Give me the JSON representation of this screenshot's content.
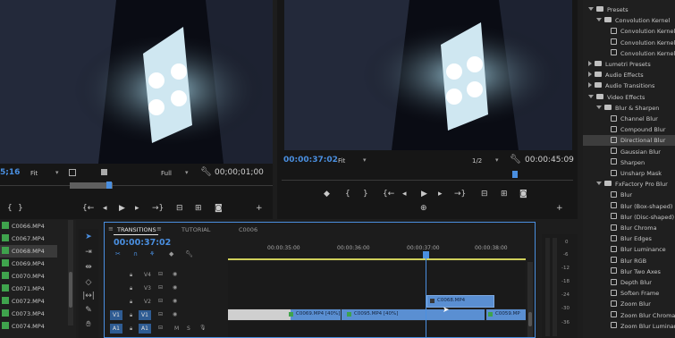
{
  "source_monitor": {
    "timecode_left": "5;16",
    "fit_label": "Fit",
    "zoom_label": "Full",
    "timecode_right": "00;00;01;00"
  },
  "program_monitor": {
    "timecode_left": "00:00:37:02",
    "fit_label": "Fit",
    "quality": "1/2",
    "timecode_right": "00:00:45:09"
  },
  "project": {
    "items": [
      "C0066.MP4",
      "C0067.MP4",
      "C0068.MP4",
      "C0069.MP4",
      "C0070.MP4",
      "C0071.MP4",
      "C0072.MP4",
      "C0073.MP4",
      "C0074.MP4"
    ],
    "selected_index": 2
  },
  "timeline": {
    "tabs": [
      "TRANSITIONS",
      "TUTORIAL",
      "C0006"
    ],
    "timecode": "00:00:37:02",
    "ruler": [
      "00:00:35:00",
      "00:00:36:00",
      "00:00:37:00",
      "00:00:38:00"
    ],
    "tracks": {
      "v4": "V4",
      "v3": "V3",
      "v2": "V2",
      "v1": "V1",
      "a1": "A1",
      "v1_src": "V1",
      "a1_src": "A1",
      "m": "M",
      "s": "S"
    },
    "clips": {
      "v2_clip": "C0068.MP4",
      "v1_a": "C0069.MP4 [40%]",
      "v1_b": "C0095.MP4 [40%]",
      "v1_c": "C0059.MP"
    }
  },
  "meter": {
    "labels": [
      "0",
      "-6",
      "-12",
      "-18",
      "-24",
      "-30",
      "-36"
    ]
  },
  "effects": {
    "rows": [
      {
        "text": "Presets",
        "icon": "folder",
        "indent": 1,
        "twirl": "down"
      },
      {
        "text": "Convolution Kernel",
        "icon": "folder",
        "indent": 2,
        "twirl": "down"
      },
      {
        "text": "Convolution Kernel Bl",
        "icon": "fx",
        "indent": 3
      },
      {
        "text": "Convolution Kernel Bl",
        "icon": "fx",
        "indent": 3
      },
      {
        "text": "Convolution Kernel Ga",
        "icon": "fx",
        "indent": 3
      },
      {
        "text": "Lumetri Presets",
        "icon": "folder",
        "indent": 1,
        "twirl": "right"
      },
      {
        "text": "Audio Effects",
        "icon": "folder",
        "indent": 1,
        "twirl": "right"
      },
      {
        "text": "Audio Transitions",
        "icon": "folder",
        "indent": 1,
        "twirl": "right"
      },
      {
        "text": "Video Effects",
        "icon": "folder",
        "indent": 1,
        "twirl": "down"
      },
      {
        "text": "Blur & Sharpen",
        "icon": "folder",
        "indent": 2,
        "twirl": "down"
      },
      {
        "text": "Channel Blur",
        "icon": "fx",
        "indent": 3
      },
      {
        "text": "Compound Blur",
        "icon": "fx",
        "indent": 3
      },
      {
        "text": "Directional Blur",
        "icon": "fx",
        "indent": 3,
        "selected": true
      },
      {
        "text": "Gaussian Blur",
        "icon": "fx",
        "indent": 3
      },
      {
        "text": "Sharpen",
        "icon": "fx",
        "indent": 3
      },
      {
        "text": "Unsharp Mask",
        "icon": "fx",
        "indent": 3
      },
      {
        "text": "FxFactory Pro Blur",
        "icon": "folder",
        "indent": 2,
        "twirl": "down"
      },
      {
        "text": "Blur",
        "icon": "fx",
        "indent": 3
      },
      {
        "text": "Blur (Box-shaped)",
        "icon": "fx",
        "indent": 3
      },
      {
        "text": "Blur (Disc-shaped)",
        "icon": "fx",
        "indent": 3
      },
      {
        "text": "Blur Chroma",
        "icon": "fx",
        "indent": 3
      },
      {
        "text": "Blur Edges",
        "icon": "fx",
        "indent": 3
      },
      {
        "text": "Blur Luminance",
        "icon": "fx",
        "indent": 3
      },
      {
        "text": "Blur RGB",
        "icon": "fx",
        "indent": 3
      },
      {
        "text": "Blur Two Axes",
        "icon": "fx",
        "indent": 3
      },
      {
        "text": "Depth Blur",
        "icon": "fx",
        "indent": 3
      },
      {
        "text": "Soften Frame",
        "icon": "fx",
        "indent": 3
      },
      {
        "text": "Zoom Blur",
        "icon": "fx",
        "indent": 3
      },
      {
        "text": "Zoom Blur Chroma",
        "icon": "fx",
        "indent": 3
      },
      {
        "text": "Zoom Blur Luminance",
        "icon": "fx",
        "indent": 3
      }
    ]
  },
  "colors": {
    "accent_blue": "#4a8fe0",
    "clip_blue": "#5a8fd2",
    "clip_grey": "#cfcfcf",
    "work_area_yellow": "#cfcf5a",
    "audio_green": "#3fa34d"
  }
}
